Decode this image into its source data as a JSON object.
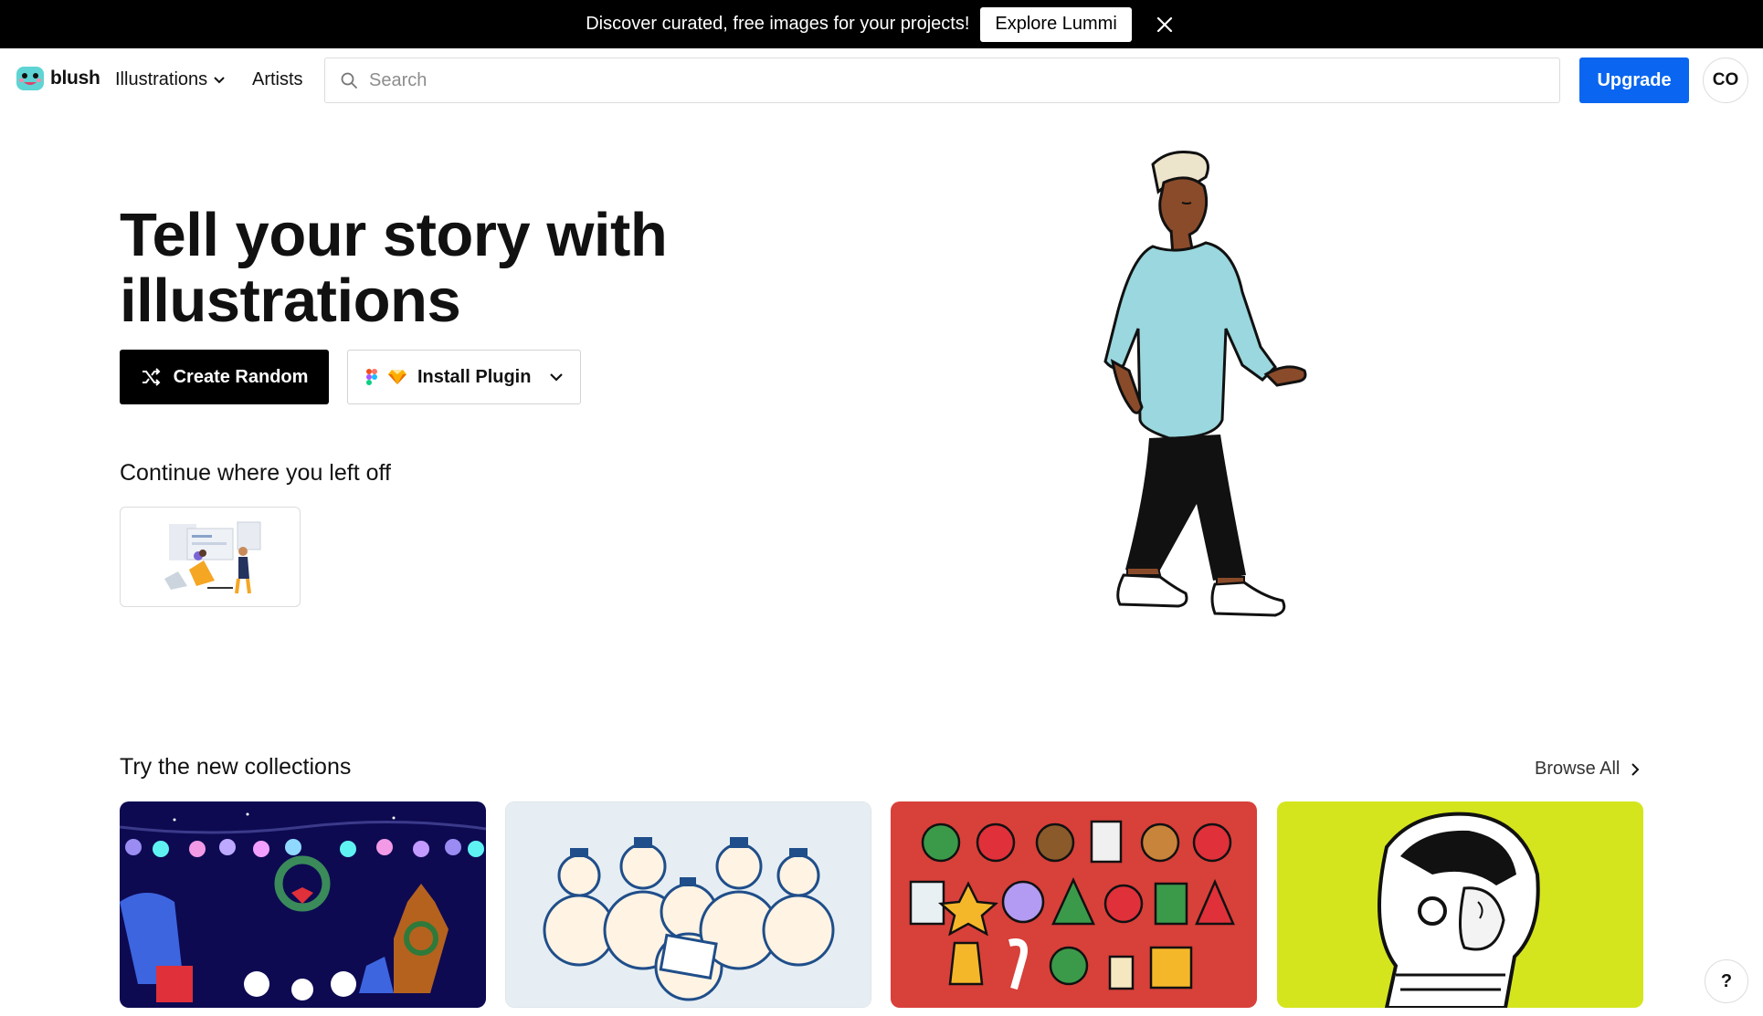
{
  "banner": {
    "text": "Discover curated, free images for your projects!",
    "button_label": "Explore Lummi",
    "close_icon": "close-icon"
  },
  "nav": {
    "logo_text": "blush",
    "illustrations_label": "Illustrations",
    "artists_label": "Artists",
    "search_placeholder": "Search",
    "upgrade_label": "Upgrade",
    "avatar_initials": "CO"
  },
  "hero": {
    "title": "Tell your story with illustrations",
    "create_random_label": "Create Random",
    "install_plugin_label": "Install Plugin"
  },
  "continue": {
    "title": "Continue where you left off"
  },
  "collections": {
    "title": "Try the new collections",
    "browse_all_label": "Browse All"
  },
  "help": {
    "label": "?"
  },
  "colors": {
    "primary_blue": "#0a66f0",
    "banner_bg": "#000000",
    "card_navy": "#0d0a52",
    "card_ice": "#e6eef3",
    "card_red": "#d8403a",
    "card_lime": "#d4e51e"
  }
}
